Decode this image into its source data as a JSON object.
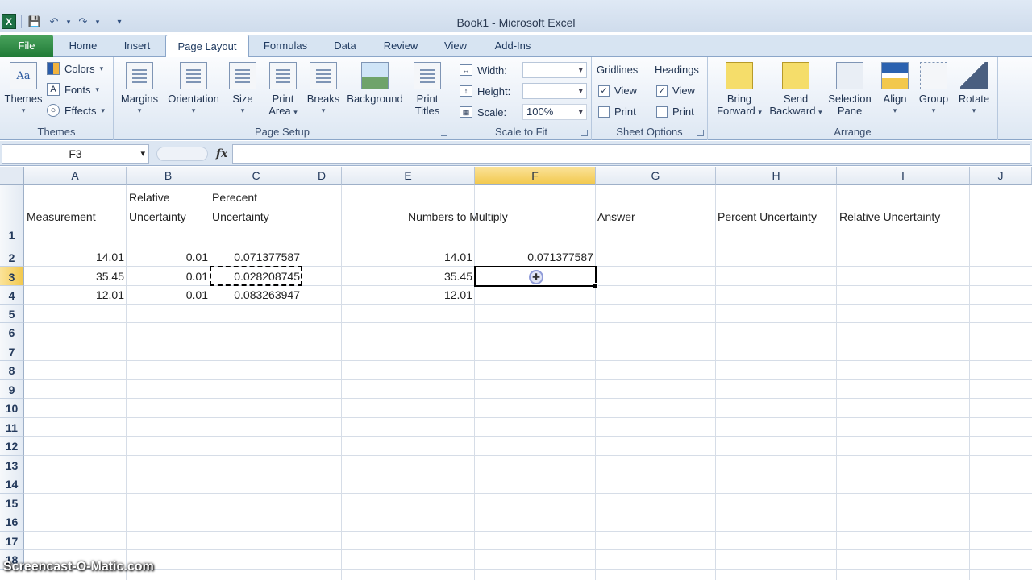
{
  "window": {
    "title": "Book1  -  Microsoft Excel"
  },
  "ribbon_tabs": [
    "File",
    "Home",
    "Insert",
    "Page Layout",
    "Formulas",
    "Data",
    "Review",
    "View",
    "Add-Ins"
  ],
  "active_tab": "Page Layout",
  "ribbon": {
    "themes_group": {
      "themes": "Themes",
      "colors": "Colors",
      "fonts": "Fonts",
      "effects": "Effects",
      "label": "Themes"
    },
    "page_setup": {
      "margins": "Margins",
      "orientation": "Orientation",
      "size": "Size",
      "print_area": "Print Area",
      "print_area_l1": "Print",
      "print_area_l2": "Area",
      "breaks": "Breaks",
      "background": "Background",
      "print_titles_l1": "Print",
      "print_titles_l2": "Titles",
      "label": "Page Setup"
    },
    "scale_to_fit": {
      "width_label": "Width:",
      "height_label": "Height:",
      "scale_label": "Scale:",
      "scale_value": "100%",
      "label": "Scale to Fit"
    },
    "sheet_options": {
      "gridlines": "Gridlines",
      "headings": "Headings",
      "view": "View",
      "print": "Print",
      "label": "Sheet Options"
    },
    "arrange": {
      "bring_forward_l1": "Bring",
      "bring_forward_l2": "Forward",
      "send_backward_l1": "Send",
      "send_backward_l2": "Backward",
      "selection_pane_l1": "Selection",
      "selection_pane_l2": "Pane",
      "align": "Align",
      "group": "Group",
      "rotate": "Rotate",
      "label": "Arrange"
    }
  },
  "name_box": "F3",
  "fx": "fx",
  "columns": [
    "A",
    "B",
    "C",
    "D",
    "E",
    "F",
    "G",
    "H",
    "I",
    "J"
  ],
  "selected_column": "F",
  "rows": [
    "1",
    "2",
    "3",
    "4",
    "5",
    "6",
    "7",
    "8",
    "9",
    "10",
    "11",
    "12",
    "13",
    "14",
    "15",
    "16",
    "17",
    "18"
  ],
  "selected_row": "3",
  "cells": {
    "A1": "Measurement",
    "B1_l1": "Relative",
    "B1_l2": "Uncertainty",
    "C1_l1": "Perecent",
    "C1_l2": "Uncertainty",
    "E1": "Numbers to Multiply",
    "G1": "Answer",
    "H1": "Percent Uncertainty",
    "I1": "Relative Uncertainty",
    "A2": "14.01",
    "B2": "0.01",
    "C2": "0.071377587",
    "E2": "14.01",
    "F2": "0.071377587",
    "A3": "35.45",
    "B3": "0.01",
    "C3": "0.028208745",
    "E3": "35.45",
    "A4": "12.01",
    "B4": "0.01",
    "C4": "0.083263947",
    "E4": "12.01"
  },
  "watermark": "Screencast-O-Matic.com"
}
